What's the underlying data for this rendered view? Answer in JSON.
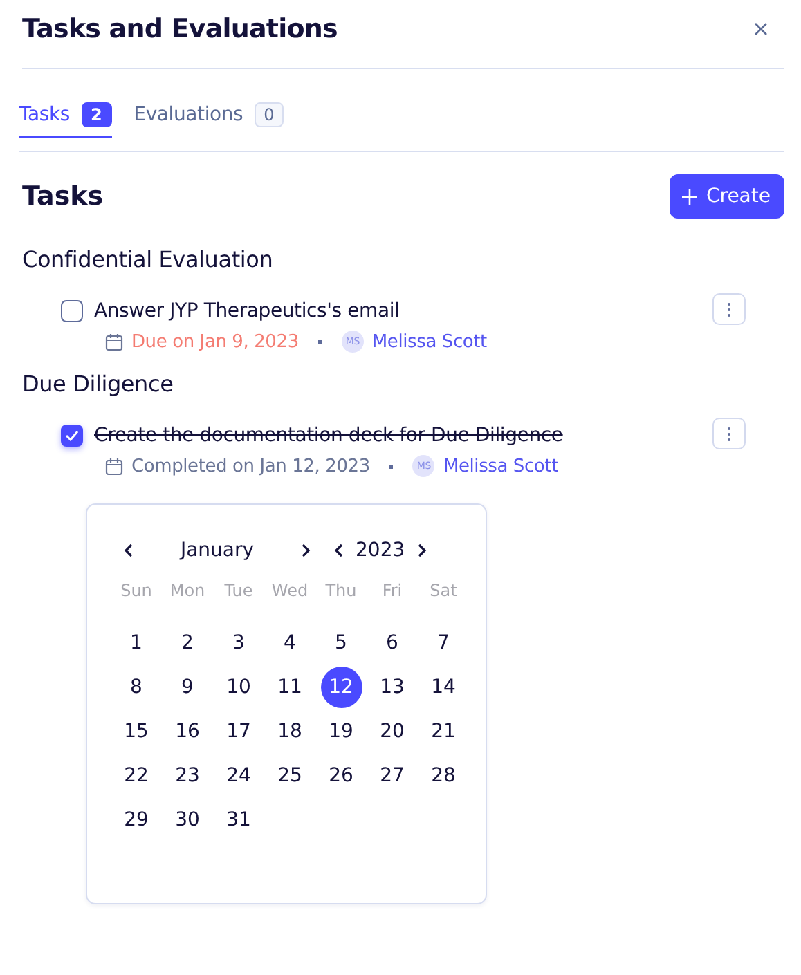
{
  "window": {
    "title": "Tasks and Evaluations"
  },
  "tabs": [
    {
      "label": "Tasks",
      "count": "2",
      "selected": true
    },
    {
      "label": "Evaluations",
      "count": "0",
      "selected": false
    }
  ],
  "section": {
    "title": "Tasks",
    "create_button": "Create"
  },
  "groups": [
    {
      "title": "Confidential Evaluation",
      "tasks": [
        {
          "title": "Answer JYP Therapeutics's email",
          "checked": false,
          "overdue": true,
          "date": "Due on Jan 9, 2023",
          "assignee_initials": "MS",
          "assignee": "Melissa Scott"
        }
      ]
    },
    {
      "title": "Due Diligence",
      "tasks": [
        {
          "title": "Create the documentation deck for Due Diligence",
          "checked": true,
          "overdue": false,
          "date": "Completed on Jan 12, 2023",
          "assignee_initials": "MS",
          "assignee": "Melissa Scott"
        }
      ]
    }
  ],
  "date_picker": {
    "month": "January",
    "year": "2023",
    "weekdays": [
      "Sun",
      "Mon",
      "Tue",
      "Wed",
      "Thu",
      "Fri",
      "Sat"
    ],
    "days": [
      {
        "label": "1",
        "selected": false
      },
      {
        "label": "2",
        "selected": false
      },
      {
        "label": "3",
        "selected": false
      },
      {
        "label": "4",
        "selected": false
      },
      {
        "label": "5",
        "selected": false
      },
      {
        "label": "6",
        "selected": false
      },
      {
        "label": "7",
        "selected": false
      },
      {
        "label": "8",
        "selected": false
      },
      {
        "label": "9",
        "selected": false
      },
      {
        "label": "10",
        "selected": false
      },
      {
        "label": "11",
        "selected": false
      },
      {
        "label": "12",
        "selected": true
      },
      {
        "label": "13",
        "selected": false
      },
      {
        "label": "14",
        "selected": false
      },
      {
        "label": "15",
        "selected": false
      },
      {
        "label": "16",
        "selected": false
      },
      {
        "label": "17",
        "selected": false
      },
      {
        "label": "18",
        "selected": false
      },
      {
        "label": "19",
        "selected": false
      },
      {
        "label": "20",
        "selected": false
      },
      {
        "label": "21",
        "selected": false
      },
      {
        "label": "22",
        "selected": false
      },
      {
        "label": "23",
        "selected": false
      },
      {
        "label": "24",
        "selected": false
      },
      {
        "label": "25",
        "selected": false
      },
      {
        "label": "26",
        "selected": false
      },
      {
        "label": "27",
        "selected": false
      },
      {
        "label": "28",
        "selected": false
      },
      {
        "label": "29",
        "selected": false
      },
      {
        "label": "30",
        "selected": false
      },
      {
        "label": "31",
        "selected": false
      }
    ]
  }
}
